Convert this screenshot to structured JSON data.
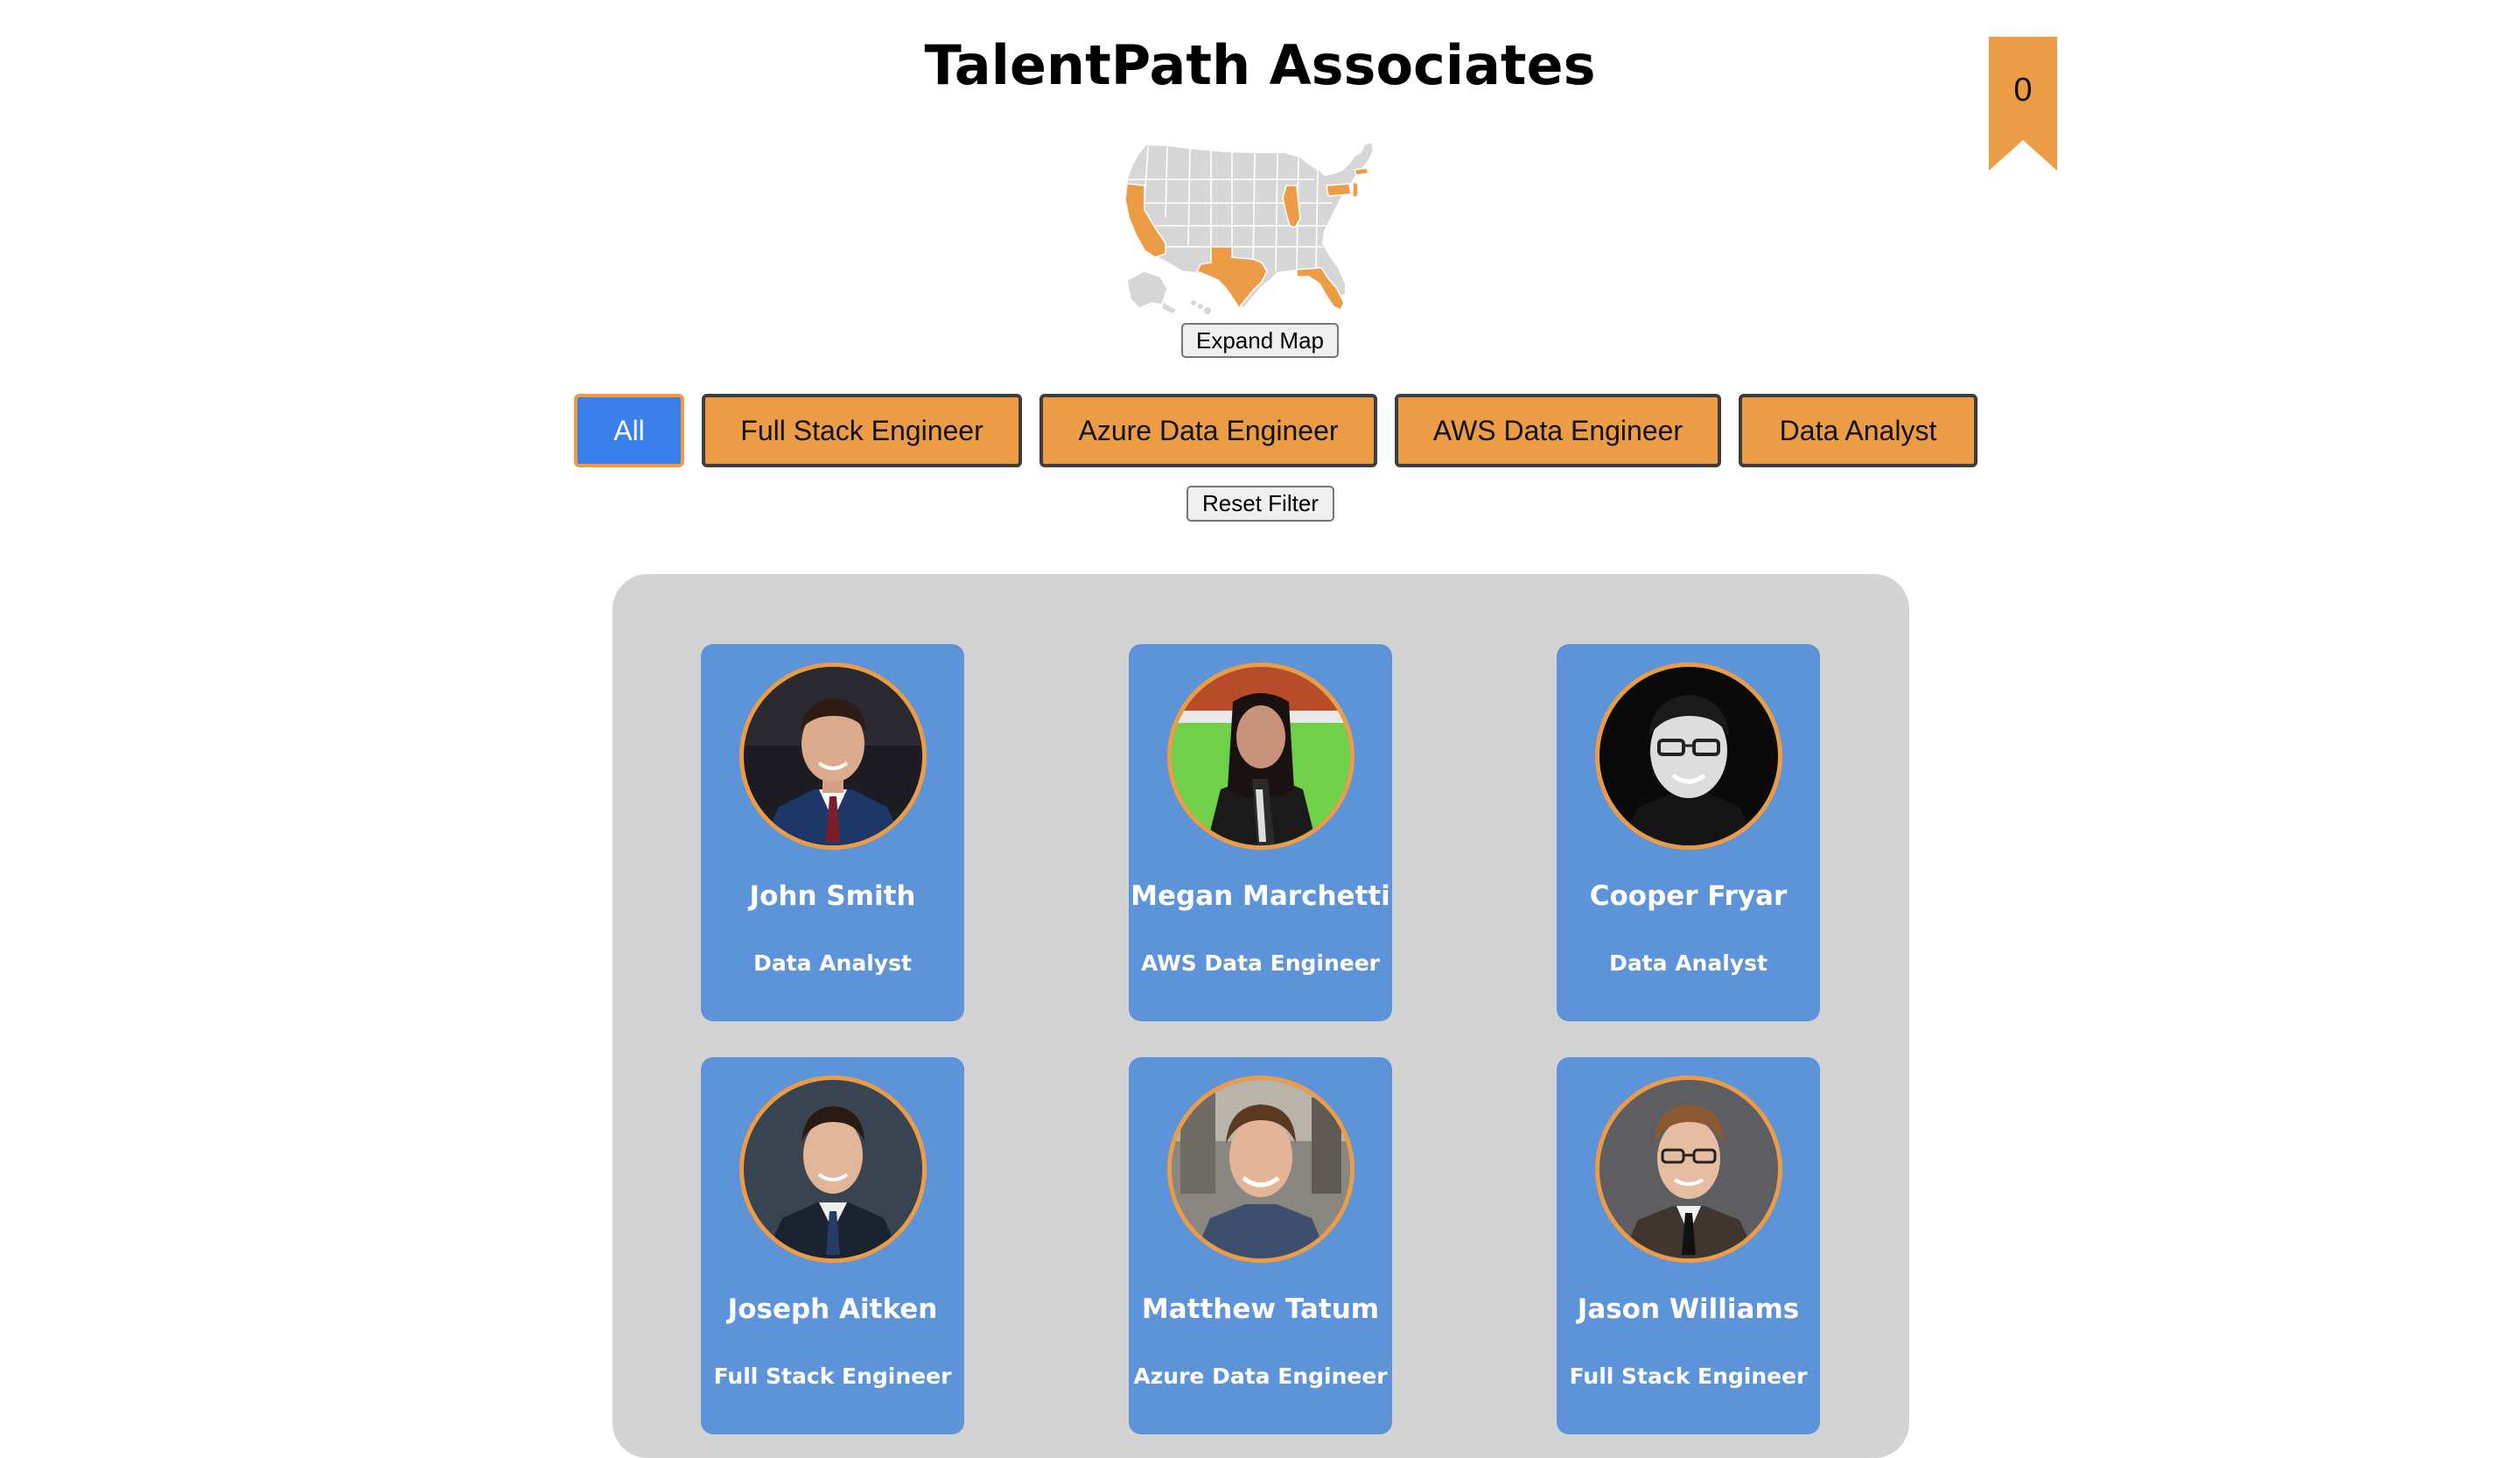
{
  "header": {
    "title": "TalentPath Associates"
  },
  "bookmark": {
    "count": "0",
    "icon": "bookmark-ribbon-icon",
    "color": "#ec9c45"
  },
  "map": {
    "icon": "us-states-map",
    "base_color": "#d6d6d6",
    "highlight_color": "#ec9c45",
    "highlighted_states": [
      "CA",
      "TX",
      "IL",
      "FL",
      "PA",
      "NJ",
      "MA"
    ],
    "expand_label": "Expand Map"
  },
  "filters": {
    "items": [
      {
        "label": "All",
        "active": true
      },
      {
        "label": "Full Stack Engineer",
        "active": false
      },
      {
        "label": "Azure Data Engineer",
        "active": false
      },
      {
        "label": "AWS Data Engineer",
        "active": false
      },
      {
        "label": "Data Analyst",
        "active": false
      }
    ],
    "reset_label": "Reset Filter",
    "active_color": "#3a80ea",
    "button_color": "#ec9c45"
  },
  "associates": [
    {
      "name": "John Smith",
      "role": "Data Analyst",
      "photo": "man-in-navy-suit"
    },
    {
      "name": "Megan Marchetti",
      "role": "AWS Data Engineer",
      "photo": "woman-at-stadium"
    },
    {
      "name": "Cooper Fryar",
      "role": "Data Analyst",
      "photo": "man-with-glasses-bw"
    },
    {
      "name": "Joseph Aitken",
      "role": "Full Stack Engineer",
      "photo": "man-in-suit-dark-bg"
    },
    {
      "name": "Matthew Tatum",
      "role": "Azure Data Engineer",
      "photo": "man-smiling-office"
    },
    {
      "name": "Jason Williams",
      "role": "Full Stack Engineer",
      "photo": "man-with-glasses-suit"
    }
  ],
  "card_color": "#5d93d8",
  "panel_color": "#d3d3d3"
}
